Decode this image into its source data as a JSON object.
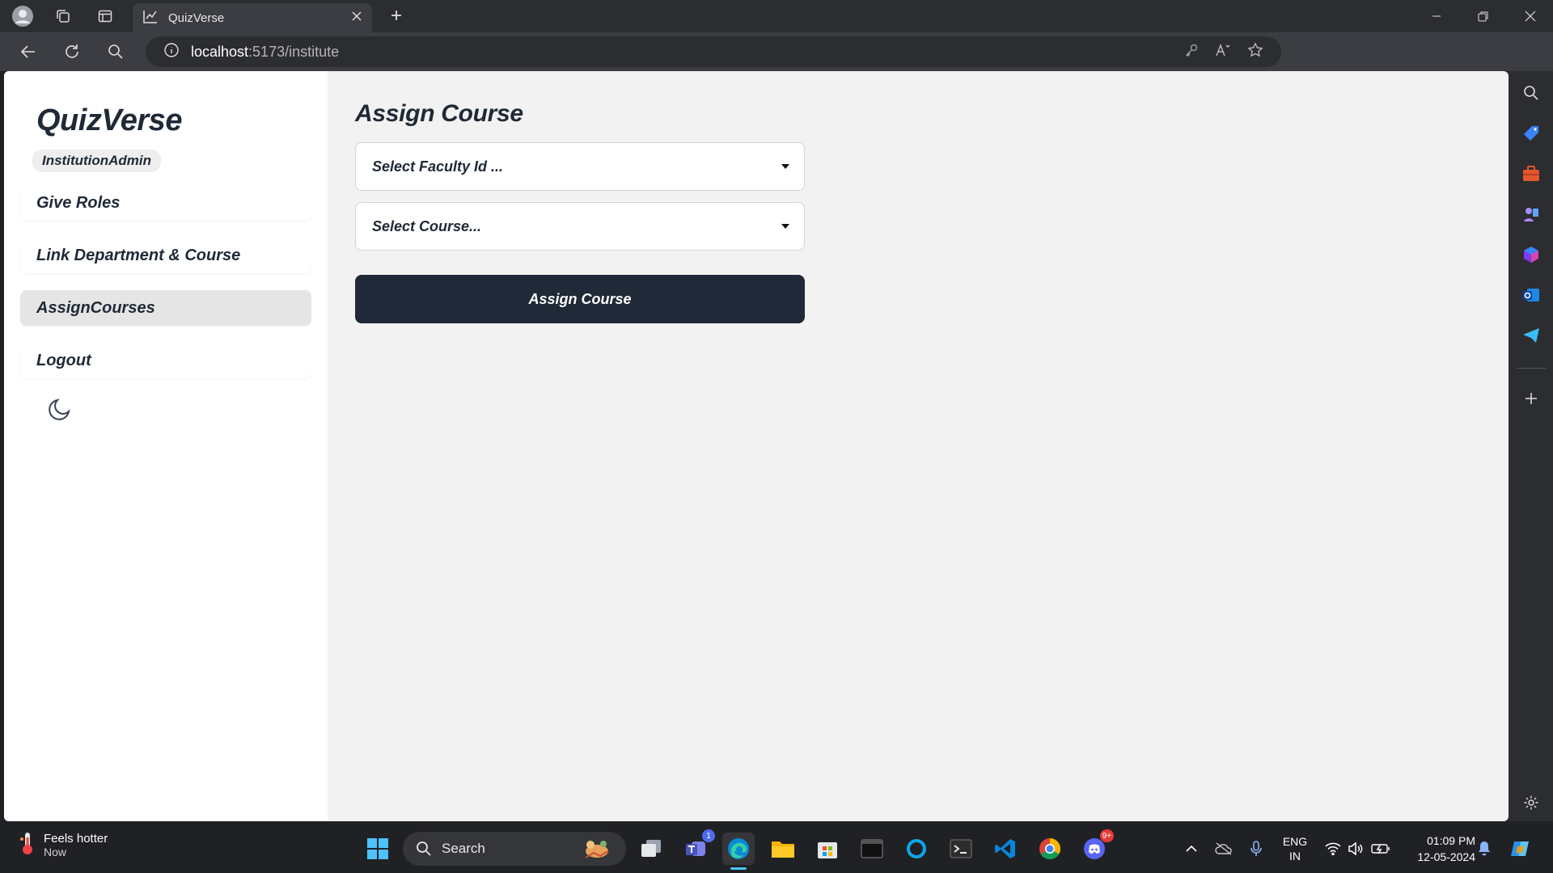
{
  "browser": {
    "tab_title": "QuizVerse",
    "url_host": "localhost",
    "url_path": ":5173/institute"
  },
  "app": {
    "logo": "QuizVerse",
    "role": "InstitutionAdmin",
    "menu": [
      {
        "label": "Give Roles",
        "active": false
      },
      {
        "label": "Link Department & Course",
        "active": false
      },
      {
        "label": "AssignCourses",
        "active": true
      },
      {
        "label": "Logout",
        "active": false
      }
    ]
  },
  "main": {
    "title": "Assign Course",
    "faculty_select": "Select Faculty Id ...",
    "course_select": "Select Course...",
    "assign_button": "Assign Course"
  },
  "taskbar": {
    "weather_title": "Feels hotter",
    "weather_sub": "Now",
    "search_placeholder": "Search",
    "teams_badge": "1",
    "discord_badge": "9+",
    "lang_1": "ENG",
    "lang_2": "IN",
    "time": "01:09 PM",
    "date": "12-05-2024"
  },
  "colors": {
    "accent_dark": "#1f2937",
    "page_bg": "#f2f2f2",
    "sidebar_bg": "#ffffff",
    "active_item": "#e5e5e5"
  }
}
